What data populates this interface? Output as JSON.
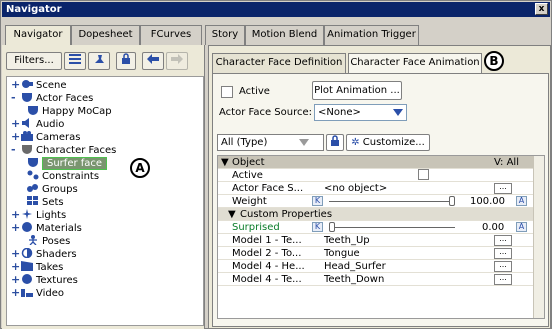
{
  "window": {
    "title": "Navigator",
    "close_glyph": "x"
  },
  "main_tabs": [
    {
      "label": "Navigator",
      "active": true
    },
    {
      "label": "Dopesheet",
      "active": false
    },
    {
      "label": "FCurves",
      "active": false
    },
    {
      "label": "Story",
      "active": false
    },
    {
      "label": "Motion Blend",
      "active": false
    },
    {
      "label": "Animation Trigger",
      "active": false
    }
  ],
  "left_toolbar": {
    "filters_label": "Filters...",
    "icons": [
      "list-view-icon",
      "pin-icon",
      "lock-icon",
      "back-arrow-icon",
      "forward-arrow-icon"
    ]
  },
  "tree": [
    {
      "label": "Scene",
      "icon": "scene-icon",
      "expand": "+"
    },
    {
      "label": "Actor Faces",
      "icon": "actor-face-icon",
      "expand": "-"
    },
    {
      "label": "Happy MoCap",
      "icon": "actor-face-icon",
      "expand": ""
    },
    {
      "label": "Audio",
      "icon": "audio-icon",
      "expand": "+"
    },
    {
      "label": "Cameras",
      "icon": "camera-icon",
      "expand": "+"
    },
    {
      "label": "Character Faces",
      "icon": "character-face-icon",
      "expand": "-"
    },
    {
      "label": "Surfer face",
      "icon": "character-face-icon",
      "expand": "",
      "selected": true
    },
    {
      "label": "Constraints",
      "icon": "constraint-icon",
      "expand": ""
    },
    {
      "label": "Groups",
      "icon": "groups-icon",
      "expand": ""
    },
    {
      "label": "Sets",
      "icon": "sets-icon",
      "expand": ""
    },
    {
      "label": "Lights",
      "icon": "light-icon",
      "expand": "+"
    },
    {
      "label": "Materials",
      "icon": "material-icon",
      "expand": "+"
    },
    {
      "label": "Poses",
      "icon": "pose-icon",
      "expand": ""
    },
    {
      "label": "Shaders",
      "icon": "shader-icon",
      "expand": "+"
    },
    {
      "label": "Takes",
      "icon": "take-icon",
      "expand": "+"
    },
    {
      "label": "Textures",
      "icon": "texture-icon",
      "expand": "+"
    },
    {
      "label": "Video",
      "icon": "video-icon",
      "expand": "+"
    }
  ],
  "markers": {
    "a": "A",
    "b": "B"
  },
  "sub_tabs": [
    {
      "label": "Character Face Definition",
      "active": false
    },
    {
      "label": "Character Face Animation",
      "active": true
    }
  ],
  "animation": {
    "active_label": "Active",
    "plot_button": "Plot Animation ...",
    "source_label": "Actor Face Source:",
    "source_value": "<None>",
    "filter_value": "All (Type)",
    "customize_label": "Customize..."
  },
  "grid": {
    "section_label": "Object",
    "section_value": "V: All",
    "rows": [
      {
        "name": "Active",
        "value": "",
        "kind": "checkbox"
      },
      {
        "name": "Actor Face S...",
        "value": "<no object>",
        "kind": "object"
      },
      {
        "name": "Weight",
        "value": "100.00",
        "kind": "slider",
        "slider_fraction": 1.0,
        "key": "K",
        "anim": "A"
      },
      {
        "name": "Custom Properties",
        "kind": "subsection"
      },
      {
        "name": "Surprised",
        "value": "0.00",
        "kind": "slider",
        "slider_fraction": 0.0,
        "key": "K",
        "anim": "A"
      },
      {
        "name": "Model 1 - Te...",
        "value": "Teeth_Up",
        "kind": "model"
      },
      {
        "name": "Model 2 - To...",
        "value": "Tongue",
        "kind": "model"
      },
      {
        "name": "Model 4 - He...",
        "value": "Head_Surfer",
        "kind": "model"
      },
      {
        "name": "Model 4 - Te...",
        "value": "Teeth_Down",
        "kind": "model"
      }
    ],
    "dots": "..."
  },
  "colors": {
    "title_bg": "#0a246a",
    "selection_bg": "#7a9570",
    "selection_border": "#4ec14e",
    "accent_blue": "#2b4fa8",
    "surprised_text": "#0a7d2a"
  }
}
